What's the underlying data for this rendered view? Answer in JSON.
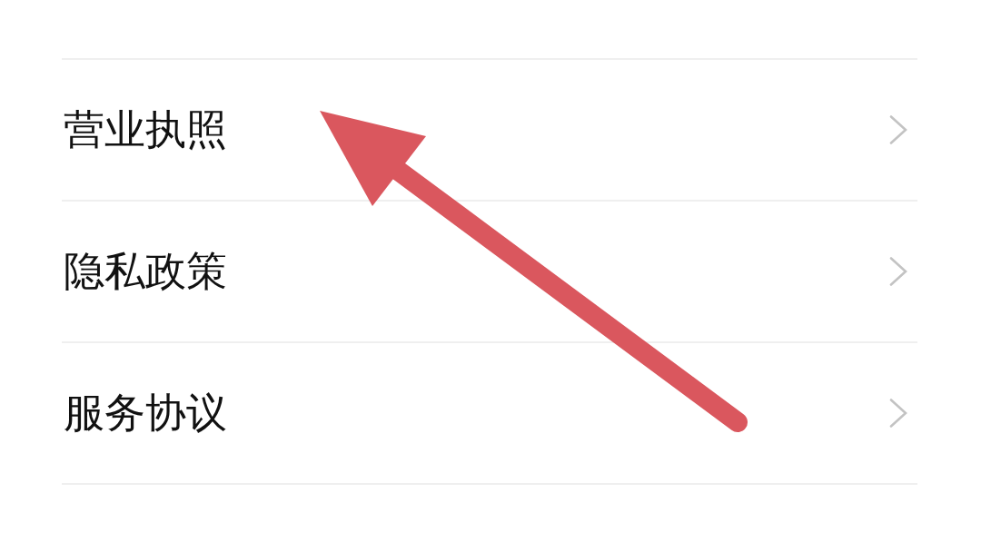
{
  "menu": {
    "items": [
      {
        "label": "营业执照"
      },
      {
        "label": "隐私政策"
      },
      {
        "label": "服务协议"
      }
    ]
  }
}
